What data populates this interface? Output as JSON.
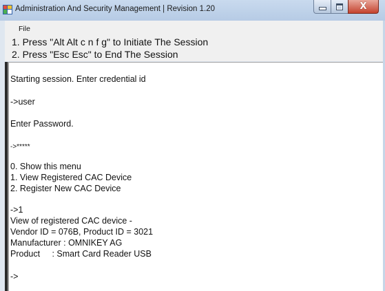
{
  "window": {
    "title": "Administration And Security Management  |  Revision 1.20",
    "icon": "app-window-icon",
    "controls": {
      "minimize_icon": "minimize-icon",
      "maximize_icon": "maximize-icon",
      "close_icon": "close-icon",
      "close_glyph": "X"
    }
  },
  "menu": {
    "items": [
      {
        "label": "File"
      }
    ]
  },
  "instructions": [
    "1. Press \"Alt Alt c n f g\" to Initiate The Session",
    "2. Press \"Esc Esc\" to End The Session"
  ],
  "console": {
    "lines": [
      "Starting session. Enter credential id",
      "->user",
      "Enter Password.",
      "->*****",
      "0. Show this menu",
      "1. View Registered CAC Device",
      "2. Register New CAC Device",
      "->1",
      "View of registered CAC device -",
      "Vendor ID = 076B, Product ID = 3021",
      "Manufacturer : OMNIKEY AG",
      "Product     : Smart Card Reader USB",
      "->"
    ]
  },
  "colors": {
    "titlebar": "#b6cbe5",
    "close_button": "#c4432f",
    "panel": "#f0f0f0",
    "console_bg": "#ffffff"
  }
}
